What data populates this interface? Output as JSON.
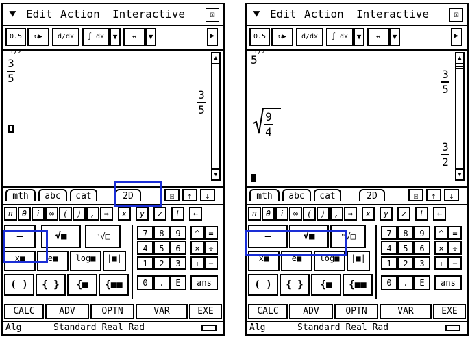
{
  "menubar": {
    "chevron": "⯆",
    "items": [
      "Edit",
      "Action",
      "Interactive"
    ],
    "close": "☒"
  },
  "toolbar": {
    "buttons": [
      "0.5 1/2",
      "↻▶",
      "d/dx",
      "∫ dx",
      "▼",
      "↔",
      "▼",
      "▶"
    ]
  },
  "left_screen": {
    "history": [
      {
        "kind": "input_fraction",
        "num": "3",
        "den": "5"
      },
      {
        "kind": "output_fraction",
        "num": "3",
        "den": "5"
      }
    ]
  },
  "right_screen": {
    "history": [
      {
        "kind": "input_plain",
        "text": "5"
      },
      {
        "kind": "output_fraction",
        "num": "3",
        "den": "5"
      },
      {
        "kind": "input_sqrt_fraction",
        "num": "9",
        "den": "4"
      },
      {
        "kind": "output_fraction",
        "num": "3",
        "den": "2"
      }
    ]
  },
  "keyboard_tabs": [
    "mth",
    "abc",
    "cat",
    "2D"
  ],
  "tab_icons": [
    "☒",
    "↑",
    "↓"
  ],
  "symbol_row": [
    "π",
    "θ",
    "i",
    "∞",
    "(",
    ")",
    ",",
    "⇒",
    "x",
    "y",
    "z",
    "t",
    "←"
  ],
  "template_keys": [
    [
      "―",
      "√■",
      "ⁿ√□"
    ],
    [
      "x■",
      "e■",
      "log■",
      "|■|"
    ],
    [
      "( )",
      "{ }",
      "{■",
      "{■■"
    ]
  ],
  "number_keys": [
    [
      "7",
      "8",
      "9",
      "^",
      "="
    ],
    [
      "4",
      "5",
      "6",
      "×",
      "÷"
    ],
    [
      "1",
      "2",
      "3",
      "+",
      "−"
    ],
    [
      "0",
      ".",
      "E",
      "ans",
      ""
    ]
  ],
  "bottom_keys": [
    "CALC",
    "ADV",
    "OPTN",
    "VAR",
    "EXE"
  ],
  "status": {
    "mode": "Alg",
    "settings": "Standard Real Rad"
  },
  "colors": {
    "highlight": "#1a2ed6"
  }
}
